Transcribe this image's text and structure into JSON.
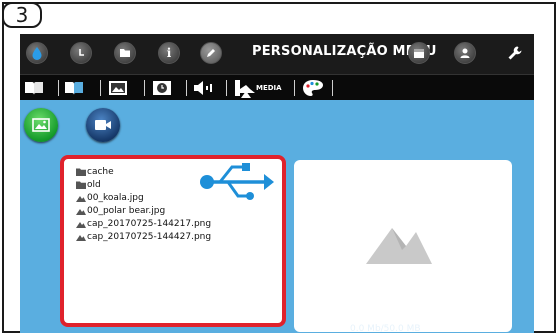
{
  "step_badge": "3",
  "topbar": {
    "menu_title": "PERSONALIZAÇÃO MENU",
    "icons": [
      "water-drop-icon",
      "temperature-icon",
      "folder-icon",
      "info-icon",
      "edit-pencil-icon",
      "calendar-icon",
      "user-icon",
      "wrench-icon"
    ]
  },
  "subbar": {
    "media_label": "MEDIA",
    "icons": [
      "open-book-icon",
      "book-icon",
      "image-icon",
      "clock-icon",
      "speaker-icon",
      "media-icon",
      "palette-icon"
    ]
  },
  "modes": [
    "photo-mode",
    "video-mode"
  ],
  "file_list": [
    {
      "type": "folder",
      "name": "cache"
    },
    {
      "type": "folder",
      "name": "old"
    },
    {
      "type": "image",
      "name": "00_koala.jpg"
    },
    {
      "type": "image",
      "name": "00_polar bear.jpg"
    },
    {
      "type": "image",
      "name": "cap_20170725-144217.png"
    },
    {
      "type": "image",
      "name": "cap_20170725-144427.png"
    }
  ],
  "storage": "0.0 Mb/50.0 MB",
  "colors": {
    "highlight": "#e0222c",
    "background": "#5aaee0",
    "topbar": "#1b1b1b",
    "usb": "#1e8fd8"
  }
}
